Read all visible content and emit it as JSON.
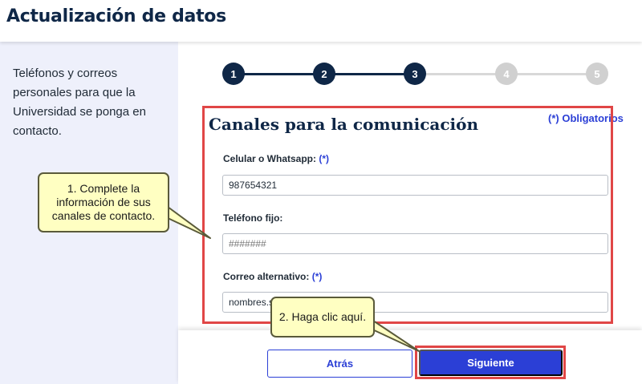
{
  "header": {
    "title": "Actualización de datos"
  },
  "sidebar": {
    "description": "Teléfonos y correos personales para que la Universidad se ponga en contacto."
  },
  "stepper": {
    "steps": [
      {
        "label": "1",
        "state": "done"
      },
      {
        "label": "2",
        "state": "done"
      },
      {
        "label": "3",
        "state": "current"
      },
      {
        "label": "4",
        "state": "pending"
      },
      {
        "label": "5",
        "state": "pending"
      }
    ]
  },
  "form": {
    "title": "Canales para la comunicación",
    "required_note": "(*) Obligatorios",
    "fields": [
      {
        "label": "Celular o Whatsapp:",
        "required_mark": "(*)",
        "value": "987654321",
        "placeholder": ""
      },
      {
        "label": "Teléfono fijo:",
        "required_mark": "",
        "value": "",
        "placeholder": "#######"
      },
      {
        "label": "Correo alternativo:",
        "required_mark": "(*)",
        "value": "nombres.s              m",
        "placeholder": ""
      }
    ]
  },
  "footer": {
    "back_label": "Atrás",
    "next_label": "Siguiente"
  },
  "annotations": {
    "callout1": "1. Complete la información de sus canales de contacto.",
    "callout2": "2. Haga clic aquí."
  },
  "colors": {
    "navy": "#0f2747",
    "accent_blue": "#2b3fd6",
    "highlight_red": "#e04646",
    "callout_yellow": "#ffffc2",
    "sidebar_bg": "#eef0fb"
  },
  "icons": {
    "cursor": "mouse-pointer-icon"
  }
}
